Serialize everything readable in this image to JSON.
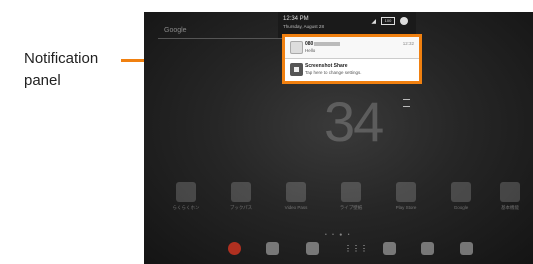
{
  "callout": {
    "label_line1": "Notification",
    "label_line2": "panel",
    "color": "#f08010"
  },
  "search": {
    "placeholder": "Google"
  },
  "status": {
    "time": "12:34 PM",
    "date": "Thursday, August 28",
    "signal_icon": "signal-icon",
    "battery": "100"
  },
  "notifications": [
    {
      "title": "080",
      "body": "Hello",
      "time": "12:32",
      "icon": "contact-icon"
    },
    {
      "title": "Screenshot Share",
      "body": "Tap here to change settings.",
      "icon": "screenshot-share-icon"
    }
  ],
  "clock": {
    "time": "34"
  },
  "apps": [
    {
      "label": "らくらくホン"
    },
    {
      "label": "ブックパス"
    },
    {
      "label": "Video Pass"
    },
    {
      "label": "ライブ壁紙"
    },
    {
      "label": "Play Store"
    },
    {
      "label": "Google"
    },
    {
      "label": "基本機能"
    }
  ],
  "page_dots": "• • ● •",
  "dock": [
    "chrome-icon",
    "email-icon",
    "contacts-icon",
    "apps-grid-icon",
    "maps-icon",
    "youtube-icon",
    "camera-icon"
  ],
  "navbar": {
    "back": "◁",
    "home": "○",
    "recent": "□"
  }
}
